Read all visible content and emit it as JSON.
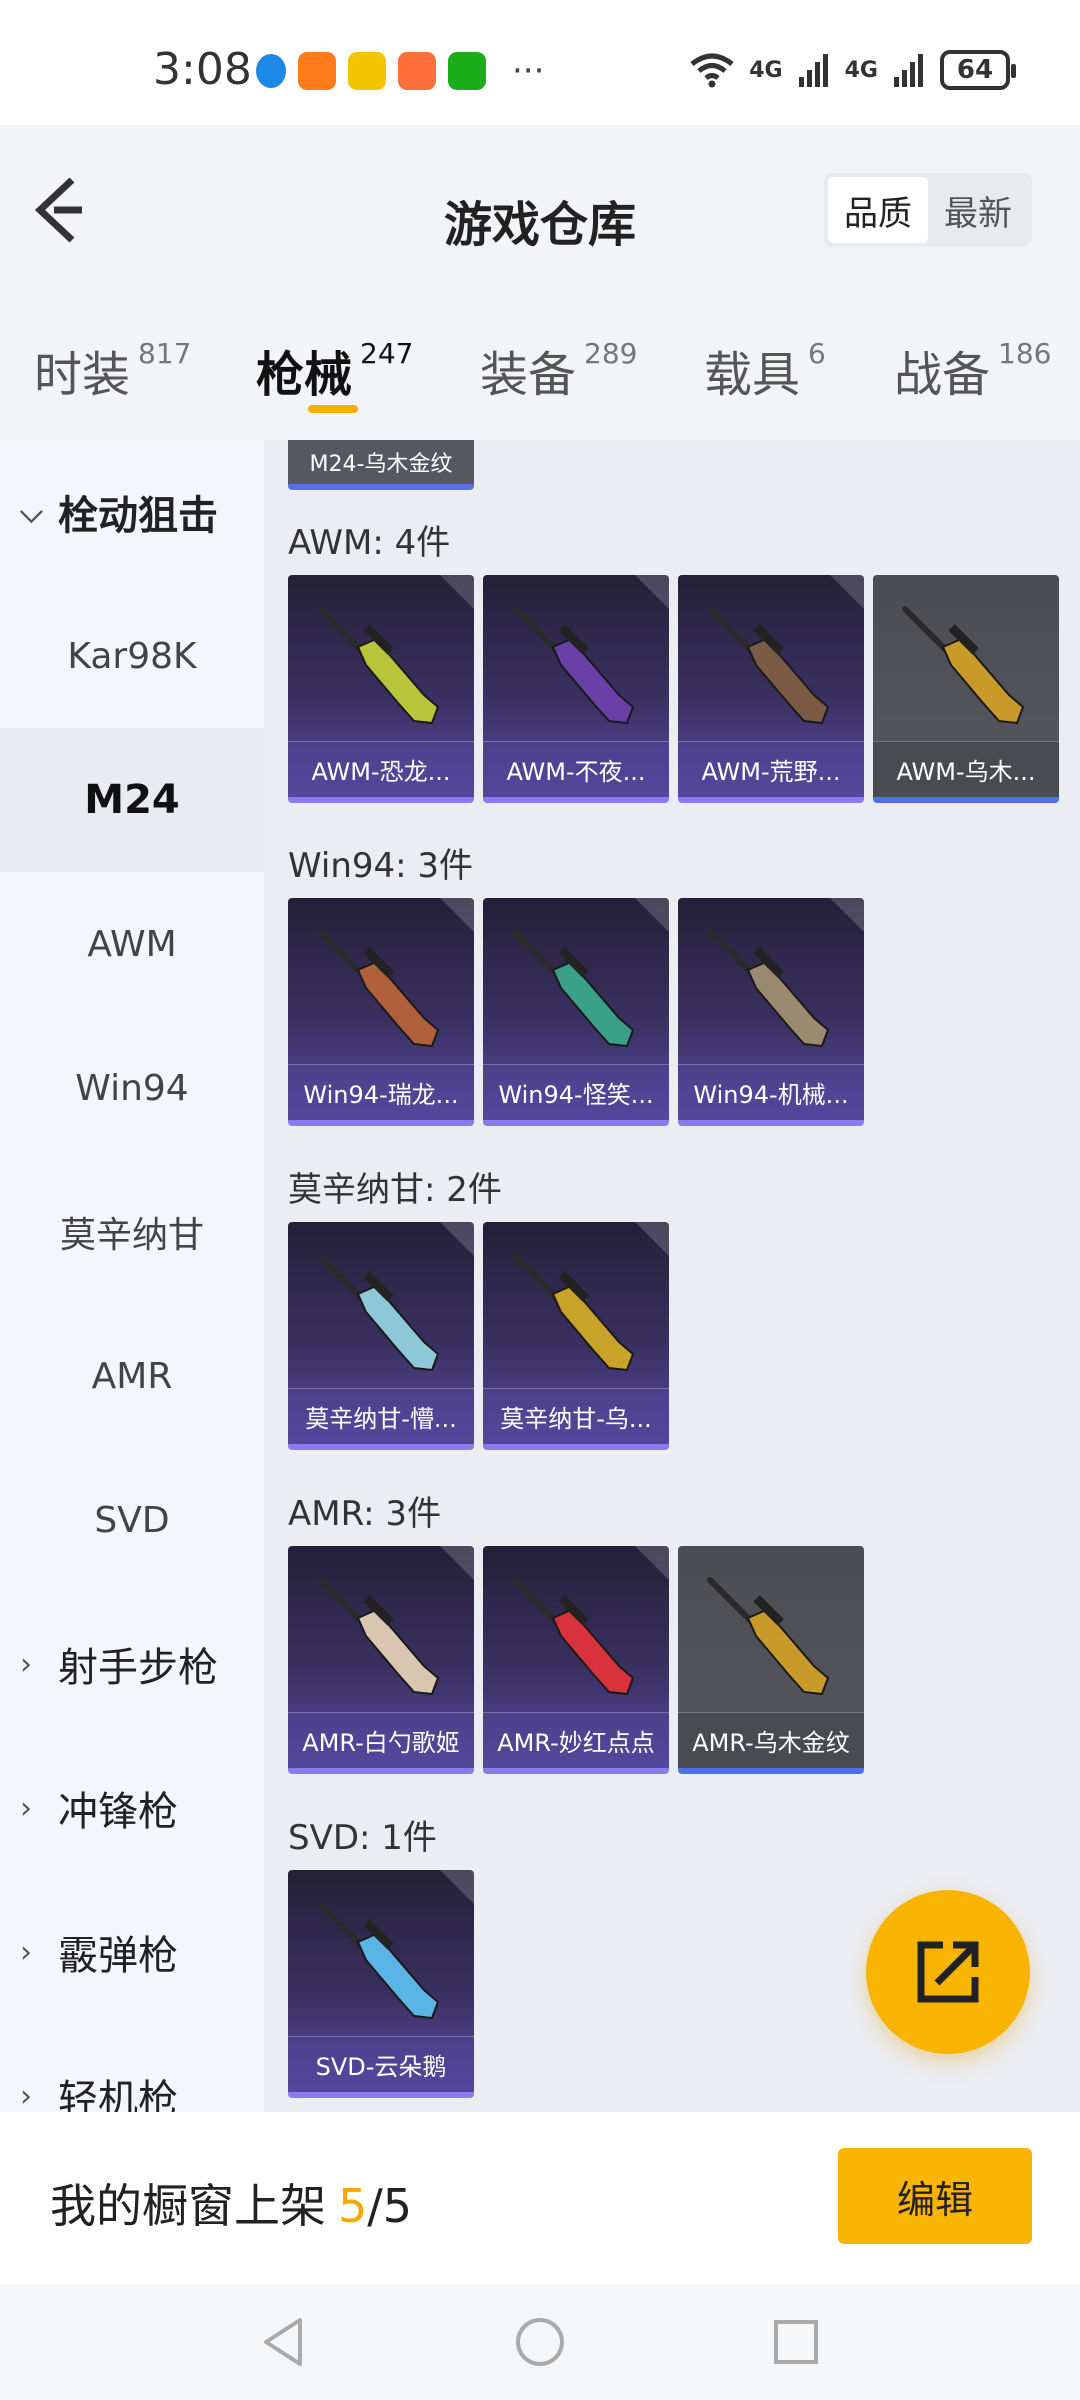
{
  "status": {
    "time": "3:08",
    "net1": "4G",
    "net2": "4G",
    "battery": "64",
    "app_colors": [
      "#1e88e5",
      "#ff7a1a",
      "#f2c500",
      "#ff6f3c",
      "#1aad19"
    ],
    "more": "···"
  },
  "header": {
    "title": "游戏仓库",
    "sort_quality": "品质",
    "sort_latest": "最新"
  },
  "tabs": [
    {
      "label": "时装",
      "count": "817"
    },
    {
      "label": "枪械",
      "count": "247"
    },
    {
      "label": "装备",
      "count": "289"
    },
    {
      "label": "载具",
      "count": "6"
    },
    {
      "label": "战备",
      "count": "186"
    }
  ],
  "sidebar": {
    "open_category": "栓动狙击",
    "items": [
      "Kar98K",
      "M24",
      "AWM",
      "Win94",
      "莫辛纳甘",
      "AMR",
      "SVD"
    ],
    "categories": [
      "射手步枪",
      "冲锋枪",
      "霰弹枪",
      "轻机枪"
    ]
  },
  "content": {
    "cut_card": "M24-乌木金纹",
    "sections": [
      {
        "title": "AWM: 4件",
        "cards": [
          {
            "name": "AWM-恐龙...",
            "color": "#b8c43a"
          },
          {
            "name": "AWM-不夜...",
            "color": "#6a3fa8"
          },
          {
            "name": "AWM-荒野...",
            "color": "#7a5a44"
          },
          {
            "name": "AWM-乌木...",
            "color": "#c79a2a"
          }
        ]
      },
      {
        "title": "Win94: 3件",
        "cards": [
          {
            "name": "Win94-瑞龙...",
            "color": "#b0603a"
          },
          {
            "name": "Win94-怪笑...",
            "color": "#3aa08a"
          },
          {
            "name": "Win94-机械...",
            "color": "#9a8a70"
          }
        ]
      },
      {
        "title": "莫辛纳甘: 2件",
        "cards": [
          {
            "name": "莫辛纳甘-懵...",
            "color": "#8ec8d8"
          },
          {
            "name": "莫辛纳甘-乌...",
            "color": "#c9a22a"
          }
        ]
      },
      {
        "title": "AMR: 3件",
        "cards": [
          {
            "name": "AMR-白勺歌姬",
            "color": "#d8c6b0"
          },
          {
            "name": "AMR-妙红点点",
            "color": "#d8323c"
          },
          {
            "name": "AMR-乌木金纹",
            "color": "#c79a2a"
          }
        ]
      },
      {
        "title": "SVD: 1件",
        "cards": [
          {
            "name": "SVD-云朵鹅",
            "color": "#5ab4e6"
          }
        ]
      }
    ]
  },
  "bottom": {
    "shelf_label": "我的橱窗上架",
    "shelf_current": "5",
    "shelf_sep": "/",
    "shelf_max": "5",
    "edit_label": "编辑"
  },
  "accent": "#f8b400"
}
